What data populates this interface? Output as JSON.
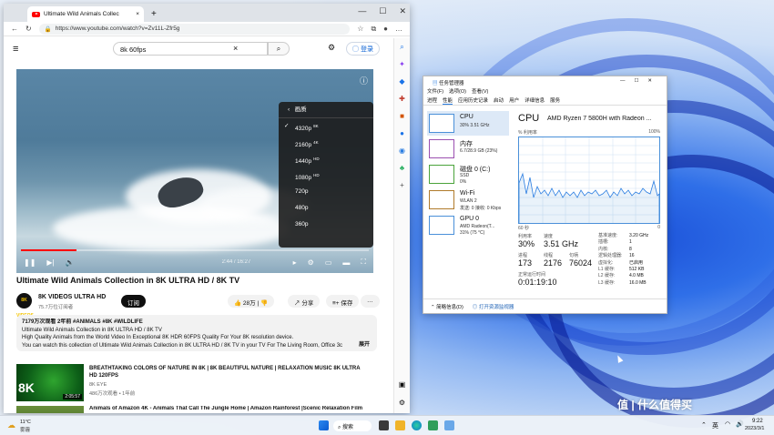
{
  "browser": {
    "tab_title": "Ultimate Wild Animals Collec",
    "tab_close": "×",
    "new_tab": "+",
    "url": "https://www.youtube.com/watch?v=Zv11L-Zfr5g",
    "win_minimize": "—",
    "win_maximize": "☐",
    "win_close": "✕"
  },
  "youtube": {
    "search_value": "8k 60fps",
    "login_label": "登录",
    "video_title": "Ultimate Wild Animals Collection in 8K ULTRA HD / 8K TV",
    "time": "2:44 / 16:27",
    "channel_avatar_text": "8K VIDEOS",
    "channel_name": "8K VIDEOS ULTRA HD",
    "channel_subs": "75.7万位订阅者",
    "subscribe_label": "订阅",
    "like_count": "28万",
    "share_label": "分享",
    "save_label": "保存",
    "quality_menu": {
      "header": "画质",
      "options": [
        {
          "label": "4320p",
          "badge": "8K",
          "selected": true
        },
        {
          "label": "2160p",
          "badge": "4K",
          "selected": false
        },
        {
          "label": "1440p",
          "badge": "HD",
          "selected": false
        },
        {
          "label": "1080p",
          "badge": "HD",
          "selected": false
        },
        {
          "label": "720p",
          "badge": "",
          "selected": false
        },
        {
          "label": "480p",
          "badge": "",
          "selected": false
        },
        {
          "label": "360p",
          "badge": "",
          "selected": false
        }
      ]
    },
    "description": {
      "meta": "7179万次观看  2年前  #ANIMALS #8K #WILDLIFE",
      "line1": "Ultimate Wild Animals Collection in 8K ULTRA HD / 8K TV",
      "line2": "High Quality Animals from the World Video In Exceptional 8K HDR 60FPS Quality For Your 8K resolution device.",
      "line3": "You can watch this collection of Ultimate Wild Animals Collection in 8K ULTRA HD / 8K TV in your TV For The Living Room, Office 3c",
      "more": "展开"
    },
    "recommendations": [
      {
        "title": "BREATHTAKING COLORS OF NATURE IN 8K | 8K BEAUTIFUL NATURE | RELAXATION MUSIC 8K ULTRA HD 120FPS",
        "channel": "8K EYE",
        "meta": "486万次观看 • 1年前",
        "duration": "2:05:57",
        "thumb_badge": "8K"
      },
      {
        "title": "Animals of Amazon 4K - Animals That Call The Jungle Home | Amazon Rainforest |Scenic Relaxation Film",
        "channel": "",
        "meta": "",
        "duration": "",
        "thumb_badge": ""
      }
    ]
  },
  "taskmgr": {
    "title": "任务管理器",
    "menu": [
      "文件(F)",
      "选项(O)",
      "查看(V)"
    ],
    "tabs": [
      "进程",
      "性能",
      "应用历史记录",
      "启动",
      "用户",
      "详细信息",
      "服务"
    ],
    "resources": [
      {
        "name": "CPU",
        "sub1": "30% 3.51 GHz",
        "sub2": "",
        "color": "#4a90d9"
      },
      {
        "name": "内存",
        "sub1": "6.7/28.9 GB (23%)",
        "sub2": "",
        "color": "#9b4fb0"
      },
      {
        "name": "磁盘 0 (C:)",
        "sub1": "SSD",
        "sub2": "0%",
        "color": "#4aa33a"
      },
      {
        "name": "Wi-Fi",
        "sub1": "WLAN 2",
        "sub2": "发送: 0 接收: 0 Kbps",
        "color": "#b07a2a"
      },
      {
        "name": "GPU 0",
        "sub1": "AMD Radeon(T...",
        "sub2": "31% (75 °C)",
        "color": "#4a90d9"
      }
    ],
    "cpu_label": "CPU",
    "cpu_model": "AMD Ryzen 7 5800H with Radeon ...",
    "graph_label": "% 利用率",
    "graph_max": "100%",
    "graph_xlabel": "60 秒",
    "graph_min": "0",
    "stats": {
      "util_label": "利用率",
      "util_value": "30%",
      "speed_label": "速度",
      "speed_value": "3.51 GHz",
      "proc_label": "进程",
      "proc_value": "173",
      "thread_label": "线程",
      "thread_value": "2176",
      "handle_label": "句柄",
      "handle_value": "76024",
      "uptime_label": "正常运行时间",
      "uptime_value": "0:01:19:10"
    },
    "specs": [
      {
        "k": "基准速度:",
        "v": "3.20 GHz"
      },
      {
        "k": "插槽:",
        "v": "1"
      },
      {
        "k": "内核:",
        "v": "8"
      },
      {
        "k": "逻辑处理器:",
        "v": "16"
      },
      {
        "k": "虚拟化:",
        "v": "已启用"
      },
      {
        "k": "L1 缓存:",
        "v": "512 KB"
      },
      {
        "k": "L2 缓存:",
        "v": "4.0 MB"
      },
      {
        "k": "L3 缓存:",
        "v": "16.0 MB"
      }
    ],
    "footer_less": "简略信息(D)",
    "footer_open": "打开资源监视器"
  },
  "taskbar": {
    "weather_temp": "11°C",
    "weather_desc": "雾霾",
    "search_label": "搜索",
    "ime": "英",
    "time": "9:22",
    "date": "2023/3/1"
  },
  "watermark": "值 | 什么值得买"
}
